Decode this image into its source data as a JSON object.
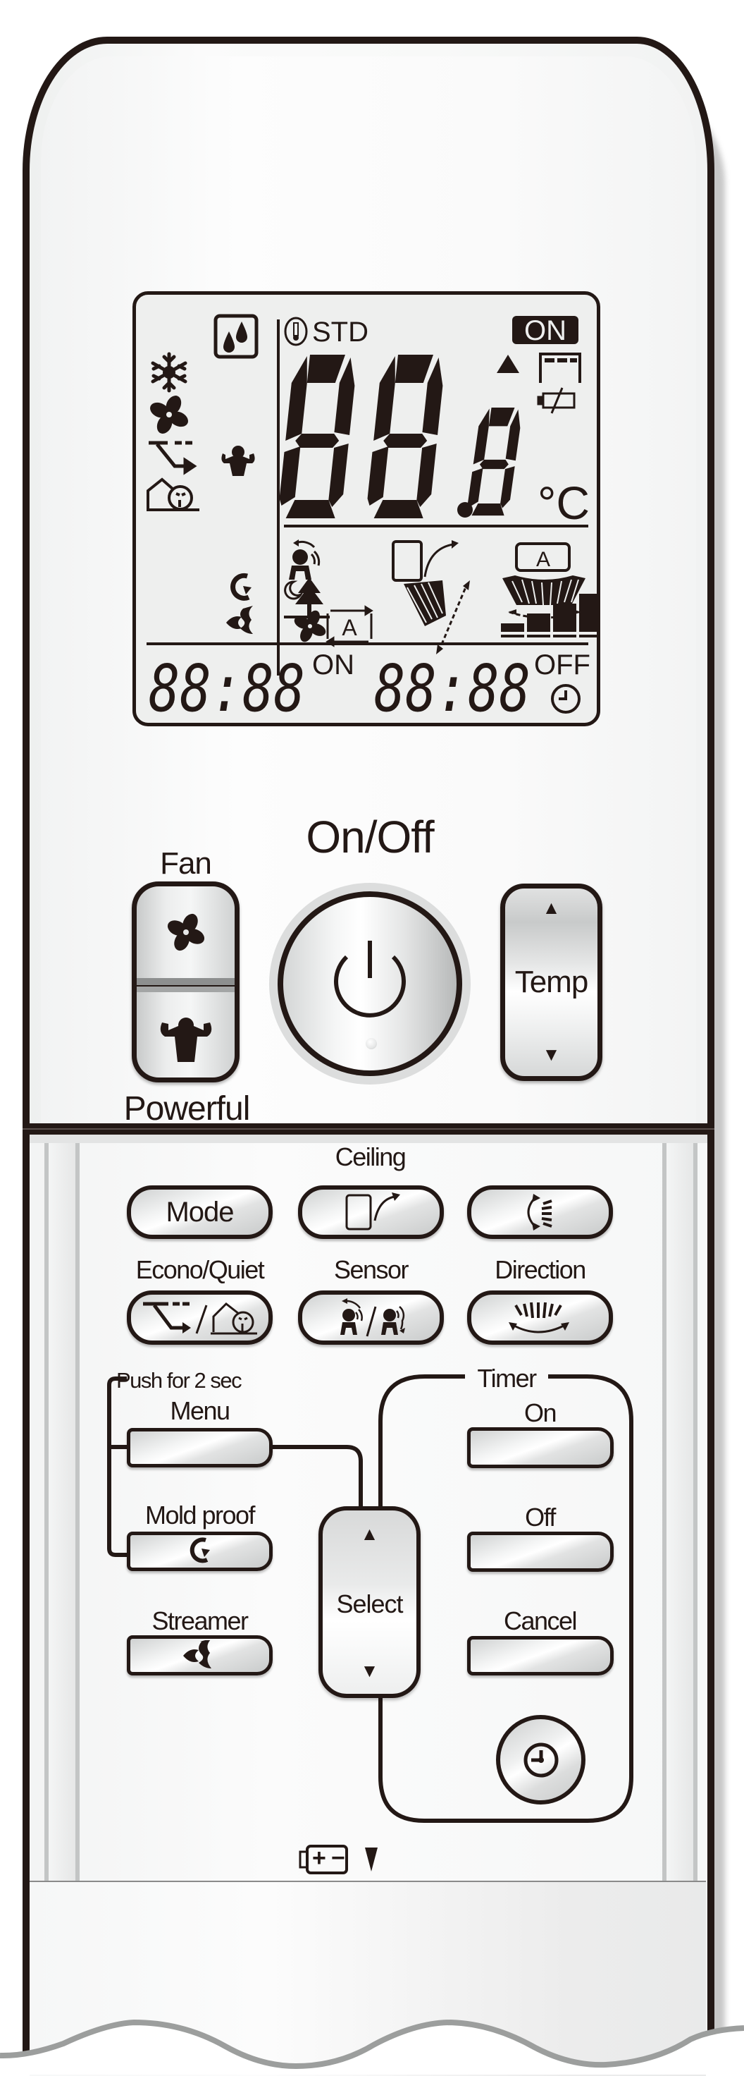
{
  "device": "Air conditioner remote controller",
  "colors": {
    "ink": "#231815",
    "lcd_background": "#eeefee",
    "button_silver": "#e6e7e7"
  },
  "lcd": {
    "indicators_left": [
      {
        "icon": "drops-icon",
        "meaning": "dry-mode"
      },
      {
        "icon": "snowflake-icon",
        "meaning": "cool-mode"
      },
      {
        "icon": "fan-icon",
        "meaning": "fan-mode"
      },
      {
        "icon": "econo-icon",
        "meaning": "econo"
      },
      {
        "icon": "powerful-icon",
        "meaning": "powerful"
      },
      {
        "icon": "quiet-icon",
        "meaning": "outdoor-unit-quiet"
      },
      {
        "icon": "mold-proof-icon",
        "meaning": "mold-proof"
      },
      {
        "icon": "streamer-icon",
        "meaning": "streamer"
      }
    ],
    "std_label": "STD",
    "on_badge": "ON",
    "temperature_digits": "88.8",
    "temperature_unit": "°C",
    "auto_label": "A",
    "fan_auto_label": "A",
    "fan_speed_levels": 5,
    "timer_on_digits": "88:88",
    "timer_on_label": "ON",
    "timer_off_digits": "88:88",
    "timer_off_label": "OFF"
  },
  "top_controls": {
    "fan_label": "Fan",
    "powerful_label": "Powerful",
    "on_off_label": "On/Off",
    "temp_label": "Temp",
    "temp_up": "▲",
    "temp_down": "▼"
  },
  "buttons": {
    "mode_label": "Mode",
    "ceiling_label": "Ceiling",
    "econo_quiet_label": "Econo/Quiet",
    "sensor_label": "Sensor",
    "direction_label": "Direction",
    "push_for_2_sec_label": "Push for 2 sec",
    "menu_label": "Menu",
    "mold_proof_label": "Mold proof",
    "streamer_label": "Streamer",
    "select_label": "Select",
    "select_up": "▲",
    "select_down": "▼",
    "timer_label": "Timer",
    "timer_on_label": "On",
    "timer_off_label": "Off",
    "cancel_label": "Cancel"
  },
  "battery": {
    "plus": "+",
    "minus": "−",
    "arrow": "▼"
  }
}
